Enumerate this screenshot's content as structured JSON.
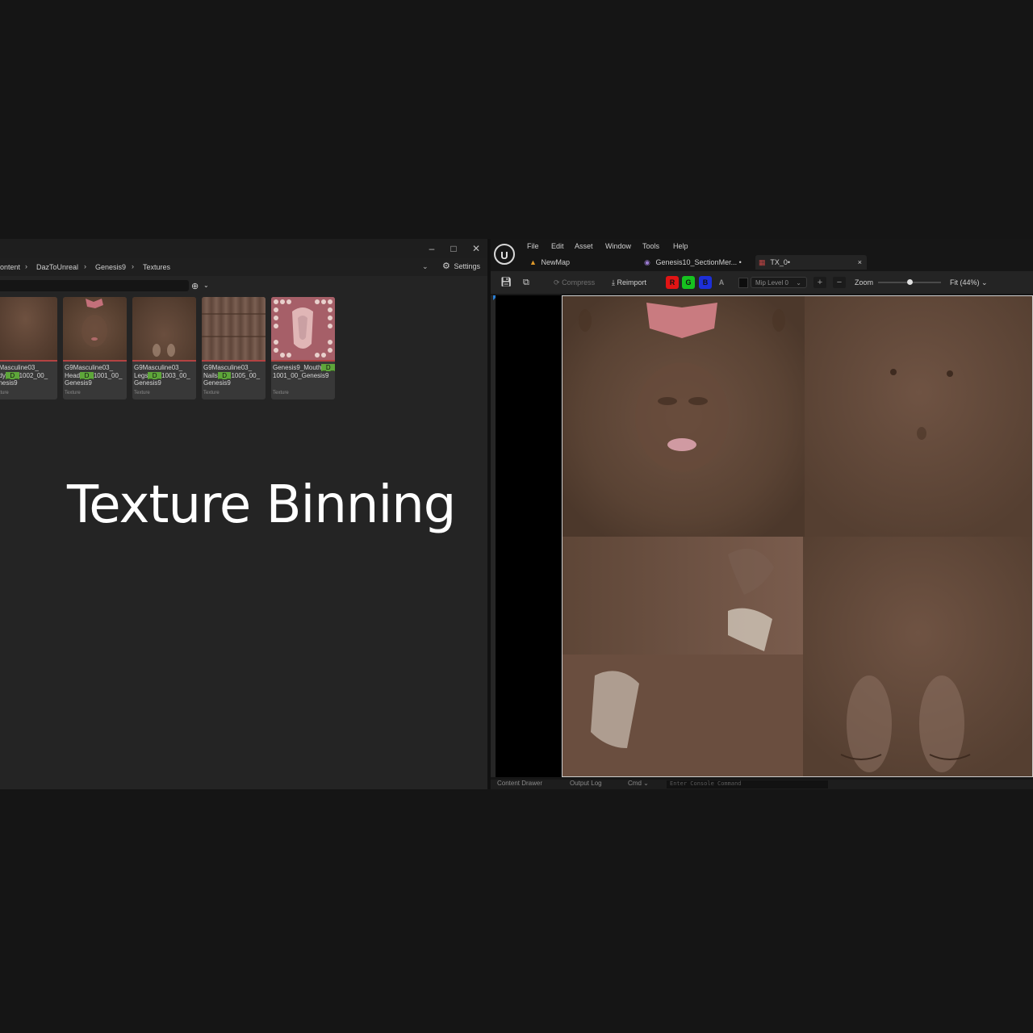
{
  "overlay_title": "Texture Binning",
  "content_browser": {
    "window_controls": {
      "minimize": "–",
      "maximize": "□",
      "close": "✕"
    },
    "breadcrumb": [
      "ontent",
      "DazToUnreal",
      "Genesis9",
      "Textures"
    ],
    "settings_label": "Settings",
    "assets": [
      {
        "line1": "9Masculine03_",
        "line2_pre": "ody",
        "line2_hl": "_D_",
        "line2_post": "1002_00_",
        "line3": "enesis9",
        "type": "exture"
      },
      {
        "line1": "G9Masculine03_",
        "line2_pre": "Head",
        "line2_hl": "_D_",
        "line2_post": "1001_00_",
        "line3": "Genesis9",
        "type": "Texture"
      },
      {
        "line1": "G9Masculine03_",
        "line2_pre": "Legs",
        "line2_hl": "_D_",
        "line2_post": "1003_00_",
        "line3": "Genesis9",
        "type": "Texture"
      },
      {
        "line1": "G9Masculine03_",
        "line2_pre": "Nails",
        "line2_hl": "_D_",
        "line2_post": "1005_00_",
        "line3": "Genesis9",
        "type": "Texture"
      },
      {
        "line1_pre": "Genesis9_Mouth",
        "line1_hl": "_D_",
        "line2": "1001_00_Genesis9",
        "type": "Texture"
      }
    ]
  },
  "texture_editor": {
    "menu": [
      "File",
      "Edit",
      "Asset",
      "Window",
      "Tools",
      "Help"
    ],
    "tabs": [
      {
        "label": "NewMap"
      },
      {
        "label": "Genesis10_SectionMer...",
        "dirty": "•"
      },
      {
        "label": "TX_0•",
        "close": "×"
      }
    ],
    "toolbar": {
      "compress": "Compress",
      "reimport": "Reimport",
      "channels": [
        "R",
        "G",
        "B",
        "A"
      ],
      "mip_level": "Mip Level 0",
      "zoom_label": "Zoom",
      "zoom_level": 0.5,
      "fit": "Fit (44%)"
    },
    "status": {
      "content_drawer": "Content Drawer",
      "output_log": "Output Log",
      "cmd": "Cmd",
      "console_placeholder": "Enter Console Command"
    }
  },
  "colors": {
    "channel_r": "#e01414",
    "channel_g": "#16c21f",
    "channel_b": "#1d2fd8",
    "error_bar": "#b34242",
    "highlight": "#5ea63a"
  }
}
